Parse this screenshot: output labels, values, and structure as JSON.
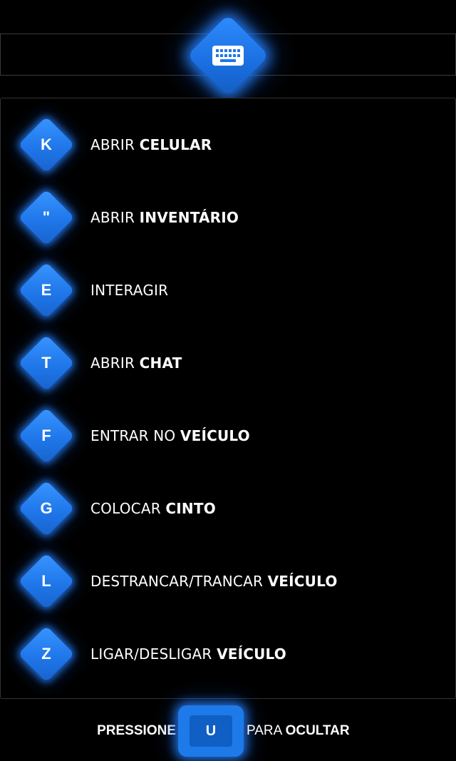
{
  "header": {
    "icon": "keyboard-icon"
  },
  "keybinds": [
    {
      "key": "K",
      "label": "ABRIR ",
      "label_bold": "CELULAR"
    },
    {
      "key": "\"",
      "label": "ABRIR ",
      "label_bold": "INVENTÁRIO"
    },
    {
      "key": "E",
      "label": "INTERAGIR",
      "label_bold": ""
    },
    {
      "key": "T",
      "label": "ABRIR ",
      "label_bold": "CHAT"
    },
    {
      "key": "F",
      "label": "ENTRAR NO ",
      "label_bold": "VEÍCULO"
    },
    {
      "key": "G",
      "label": "COLOCAR ",
      "label_bold": "CINTO"
    },
    {
      "key": "L",
      "label": "DESTRANCAR/TRANCAR ",
      "label_bold": "VEÍCULO"
    },
    {
      "key": "Z",
      "label": "LIGAR/DESLIGAR ",
      "label_bold": "VEÍCULO"
    }
  ],
  "footer": {
    "prefix": "PRESSIONE",
    "key": "U",
    "suffix": "PARA ",
    "suffix_bold": "OCULTAR"
  },
  "colors": {
    "accent": "#1f77ea",
    "background": "#000000",
    "border": "#333333"
  }
}
